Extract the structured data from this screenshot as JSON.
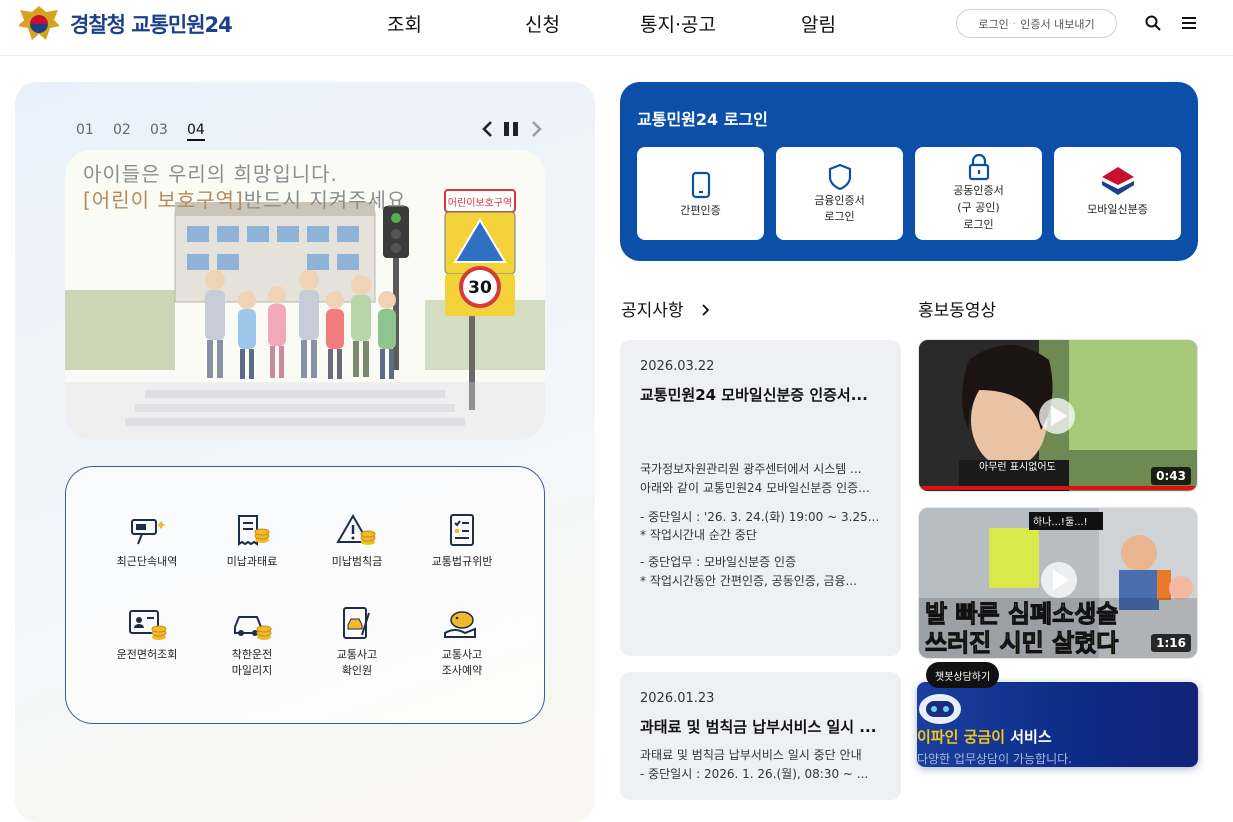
{
  "header": {
    "logo_text": "경찰청 교통민원24",
    "nav": [
      "조회",
      "신청",
      "통지·공고",
      "알림"
    ],
    "login_pill": {
      "login": "로그인",
      "export": "인증서 내보내기"
    }
  },
  "carousel": {
    "slides": [
      "01",
      "02",
      "03",
      "04"
    ],
    "active": "04",
    "banner_line1": "아이들은 우리의 희망입니다.",
    "banner_line2_highlight": "[어린이 보호구역]",
    "banner_line2_rest": "반드시 지켜주세요",
    "sign_label": "어린이보호구역",
    "speed_limit": "30"
  },
  "quick_menu": {
    "items": [
      {
        "label": "최근단속내역",
        "icon": "speed-camera-icon"
      },
      {
        "label": "미납과태료",
        "icon": "receipt-coins-icon"
      },
      {
        "label": "미납범칙금",
        "icon": "warning-coins-icon"
      },
      {
        "label": "교통법규위반",
        "icon": "checklist-doc-icon"
      },
      {
        "label": "운전면허조회",
        "icon": "license-card-icon"
      },
      {
        "label": "착한운전\n마일리지",
        "icon": "car-coins-icon"
      },
      {
        "label": "교통사고\n확인원",
        "icon": "accident-doc-icon"
      },
      {
        "label": "교통사고\n조사예약",
        "icon": "piggy-bank-icon"
      }
    ]
  },
  "login_card": {
    "title": "교통민원24 로그인",
    "buttons": [
      {
        "label": "간편인증"
      },
      {
        "label": "금융인증서\n로그인"
      },
      {
        "label": "공동인증서\n(구 공인)\n로그인"
      },
      {
        "label": "모바일신분증"
      }
    ]
  },
  "notices": {
    "title": "공지사항",
    "items": [
      {
        "date": "2026.03.22",
        "title": "교통민원24 모바일신분증 인증서...",
        "lines": [
          "국가정보자원관리원 광주센터에서 시스템 ...",
          " 아래와 같이 교통민원24 모바일신분증 인증...",
          "- 중단일시 : '26. 3. 24.(화) 19:00 ~ 3.25...",
          "   * 작업시간내 순간 중단",
          "- 중단업무 : 모바일신분증 인증",
          "   * 작업시간동안 간편인증, 공동인증, 금융..."
        ]
      },
      {
        "date": "2026.01.23",
        "title": "과태료 및 범칙금 납부서비스 일시 ...",
        "lines": [
          "과태료 및 범칙금 납부서비스 일시 중단 안내",
          " - 중단일시 : 2026. 1. 26.(월), 08:30 ~  ..."
        ]
      }
    ]
  },
  "videos": {
    "title": "홍보동영상",
    "items": [
      {
        "caption": "아무런 표시없어도",
        "duration": "0:43"
      },
      {
        "caption_line1": "발 빠른 심폐소생술",
        "caption_line2": "쓰러진 시민 살렸다",
        "top_tag": "하나...!둘...!",
        "duration": "1:16"
      }
    ]
  },
  "chatbot": {
    "tooltip": "챗봇상담하기",
    "title_highlight": "이파인 궁금이",
    "title_rest": " 서비스",
    "subtitle": "다양한 업무상담이 가능합니다."
  },
  "colors": {
    "brand_blue": "#0b4fa8",
    "logo_navy": "#1e3f8a",
    "highlight_yellow": "#f5c518"
  }
}
